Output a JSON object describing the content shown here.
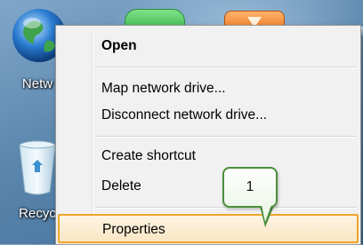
{
  "desktop": {
    "network_label": "Netw",
    "recycle_label": "Recyc"
  },
  "context_menu": {
    "items": [
      {
        "label": "Open"
      },
      {
        "label": "Map network drive..."
      },
      {
        "label": "Disconnect network drive..."
      },
      {
        "label": "Create shortcut"
      },
      {
        "label": "Delete"
      },
      {
        "label": "Properties"
      }
    ]
  },
  "callout": {
    "number": "1"
  },
  "colors": {
    "highlight_border": "#f0a52a",
    "callout_border": "#4c8f3d"
  }
}
